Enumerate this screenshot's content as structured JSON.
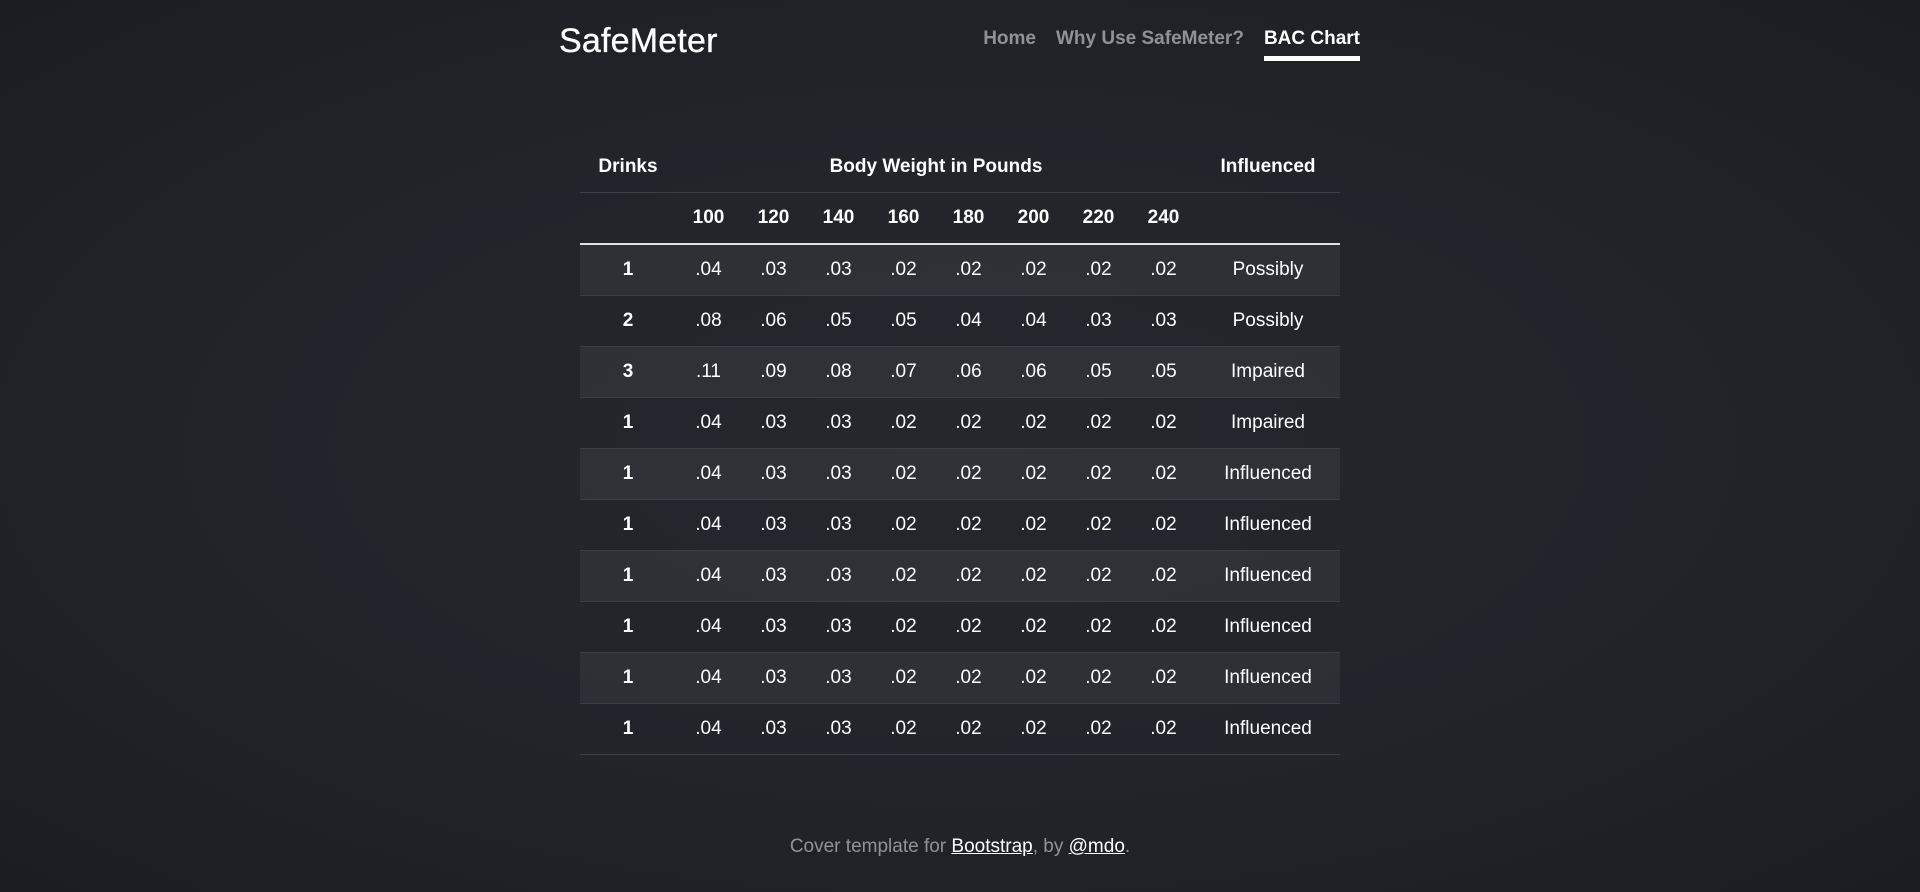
{
  "brand": "SafeMeter",
  "nav": [
    {
      "label": "Home",
      "active": false
    },
    {
      "label": "Why Use SafeMeter?",
      "active": false
    },
    {
      "label": "BAC Chart",
      "active": true
    }
  ],
  "table": {
    "header_drinks": "Drinks",
    "header_weight": "Body Weight in Pounds",
    "header_influenced": "Influenced",
    "weights": [
      "100",
      "120",
      "140",
      "160",
      "180",
      "200",
      "220",
      "240"
    ],
    "rows": [
      {
        "drinks": "1",
        "values": [
          ".04",
          ".03",
          ".03",
          ".02",
          ".02",
          ".02",
          ".02",
          ".02"
        ],
        "status": "Possibly"
      },
      {
        "drinks": "2",
        "values": [
          ".08",
          ".06",
          ".05",
          ".05",
          ".04",
          ".04",
          ".03",
          ".03"
        ],
        "status": "Possibly"
      },
      {
        "drinks": "3",
        "values": [
          ".11",
          ".09",
          ".08",
          ".07",
          ".06",
          ".06",
          ".05",
          ".05"
        ],
        "status": "Impaired"
      },
      {
        "drinks": "1",
        "values": [
          ".04",
          ".03",
          ".03",
          ".02",
          ".02",
          ".02",
          ".02",
          ".02"
        ],
        "status": "Impaired"
      },
      {
        "drinks": "1",
        "values": [
          ".04",
          ".03",
          ".03",
          ".02",
          ".02",
          ".02",
          ".02",
          ".02"
        ],
        "status": "Influenced"
      },
      {
        "drinks": "1",
        "values": [
          ".04",
          ".03",
          ".03",
          ".02",
          ".02",
          ".02",
          ".02",
          ".02"
        ],
        "status": "Influenced"
      },
      {
        "drinks": "1",
        "values": [
          ".04",
          ".03",
          ".03",
          ".02",
          ".02",
          ".02",
          ".02",
          ".02"
        ],
        "status": "Influenced"
      },
      {
        "drinks": "1",
        "values": [
          ".04",
          ".03",
          ".03",
          ".02",
          ".02",
          ".02",
          ".02",
          ".02"
        ],
        "status": "Influenced"
      },
      {
        "drinks": "1",
        "values": [
          ".04",
          ".03",
          ".03",
          ".02",
          ".02",
          ".02",
          ".02",
          ".02"
        ],
        "status": "Influenced"
      },
      {
        "drinks": "1",
        "values": [
          ".04",
          ".03",
          ".03",
          ".02",
          ".02",
          ".02",
          ".02",
          ".02"
        ],
        "status": "Influenced"
      }
    ]
  },
  "footer": {
    "prefix": "Cover template for ",
    "link1": "Bootstrap",
    "middle": ", by ",
    "link2": "@mdo",
    "suffix": "."
  }
}
